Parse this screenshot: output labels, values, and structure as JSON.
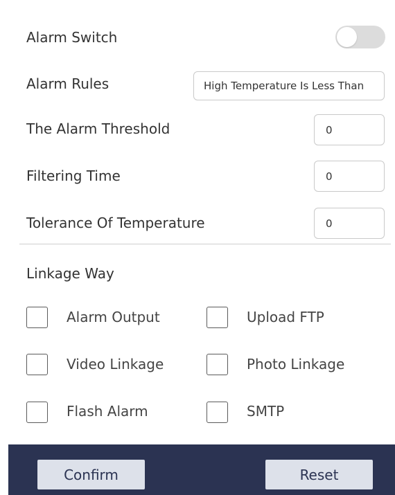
{
  "alarm_switch": {
    "label": "Alarm Switch",
    "enabled": false
  },
  "alarm_rules": {
    "label": "Alarm Rules",
    "value": "High Temperature Is Less Than"
  },
  "alarm_threshold": {
    "label": "The Alarm Threshold",
    "value": "0"
  },
  "filtering_time": {
    "label": "Filtering Time",
    "value": "0"
  },
  "tolerance": {
    "label": "Tolerance Of Temperature",
    "value": "0"
  },
  "linkage": {
    "title": "Linkage Way",
    "options": [
      {
        "label": "Alarm Output",
        "checked": false
      },
      {
        "label": "Upload FTP",
        "checked": false
      },
      {
        "label": "Video Linkage",
        "checked": false
      },
      {
        "label": "Photo Linkage",
        "checked": false
      },
      {
        "label": "Flash Alarm",
        "checked": false
      },
      {
        "label": "SMTP",
        "checked": false
      }
    ]
  },
  "footer": {
    "confirm_label": "Confirm",
    "reset_label": "Reset"
  },
  "colors": {
    "footer_bg": "#2b3352",
    "button_bg": "#dde1ea",
    "toggle_off": "#dcdcdc"
  }
}
